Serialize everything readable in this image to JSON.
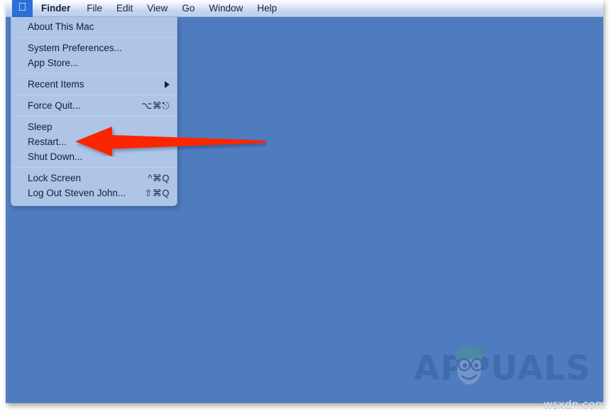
{
  "colors": {
    "desktop_background": "#4f7cbe",
    "menubar_background": "#dfe8f6",
    "menu_panel_background": "#aec5e7",
    "apple_highlight": "#2b6fd8",
    "menu_text": "#131f33",
    "arrow_red": "#fb2800",
    "watermark_blue": "#27477f",
    "mascot_green": "#4aa96c"
  },
  "menubar": {
    "apple_icon": "apple-logo-icon",
    "items": [
      {
        "label": "Finder",
        "bold": true
      },
      {
        "label": "File",
        "bold": false
      },
      {
        "label": "Edit",
        "bold": false
      },
      {
        "label": "View",
        "bold": false
      },
      {
        "label": "Go",
        "bold": false
      },
      {
        "label": "Window",
        "bold": false
      },
      {
        "label": "Help",
        "bold": false
      }
    ]
  },
  "apple_menu": {
    "groups": [
      {
        "items": [
          {
            "label": "About This Mac",
            "shortcut": "",
            "submenu": false
          }
        ]
      },
      {
        "items": [
          {
            "label": "System Preferences...",
            "shortcut": "",
            "submenu": false
          },
          {
            "label": "App Store...",
            "shortcut": "",
            "submenu": false
          }
        ]
      },
      {
        "items": [
          {
            "label": "Recent Items",
            "shortcut": "",
            "submenu": true
          }
        ]
      },
      {
        "items": [
          {
            "label": "Force Quit...",
            "shortcut": "⌥⌘⎋",
            "submenu": false
          }
        ]
      },
      {
        "items": [
          {
            "label": "Sleep",
            "shortcut": "",
            "submenu": false
          },
          {
            "label": "Restart...",
            "shortcut": "",
            "submenu": false
          },
          {
            "label": "Shut Down...",
            "shortcut": "",
            "submenu": false
          }
        ]
      },
      {
        "items": [
          {
            "label": "Lock Screen",
            "shortcut": "^⌘Q",
            "submenu": false
          },
          {
            "label": "Log Out Steven John...",
            "shortcut": "⇧⌘Q",
            "submenu": false
          }
        ]
      }
    ]
  },
  "annotation": {
    "arrow_name": "red-pointer-arrow",
    "points_at": "Restart..."
  },
  "watermark": {
    "brand": "APPUALS",
    "source": "wsxdn.com"
  }
}
